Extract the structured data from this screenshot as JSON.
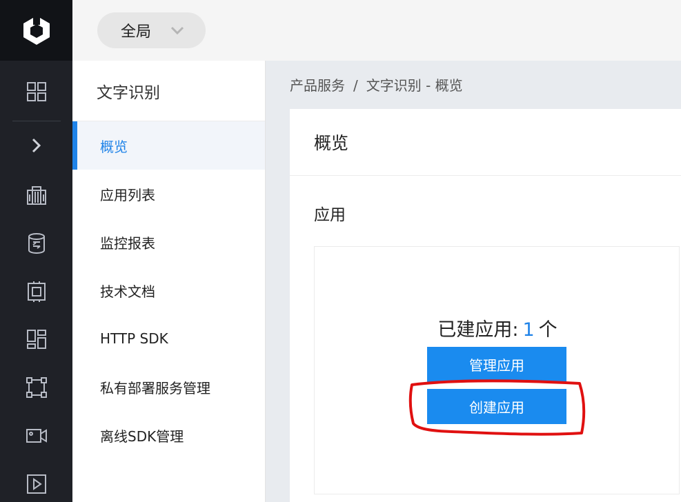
{
  "rail": {
    "icons": [
      "logo-icon",
      "dashboard-grid-icon",
      "expand-chevron-icon",
      "building-icon",
      "database-icon",
      "chip-icon",
      "layout-icon",
      "network-icon",
      "video-camera-icon",
      "play-icon"
    ]
  },
  "topbar": {
    "scope_label": "全局"
  },
  "subnav": {
    "title": "文字识别",
    "items": [
      {
        "label": "概览",
        "active": true
      },
      {
        "label": "应用列表"
      },
      {
        "label": "监控报表"
      },
      {
        "label": "技术文档"
      },
      {
        "label": "HTTP SDK"
      },
      {
        "label": "私有部署服务管理"
      },
      {
        "label": "离线SDK管理"
      }
    ]
  },
  "breadcrumb": {
    "root": "产品服务",
    "separator": "/",
    "current": "文字识别 - 概览"
  },
  "main": {
    "title": "概览",
    "section": "应用",
    "count_prefix": "已建应用:",
    "count_value": "1",
    "count_suffix": "个",
    "manage_button": "管理应用",
    "create_button": "创建应用"
  },
  "colors": {
    "accent": "#1f83e8",
    "button": "#1a8bef",
    "rail_bg": "#1f2127",
    "annotation": "#e01010"
  }
}
